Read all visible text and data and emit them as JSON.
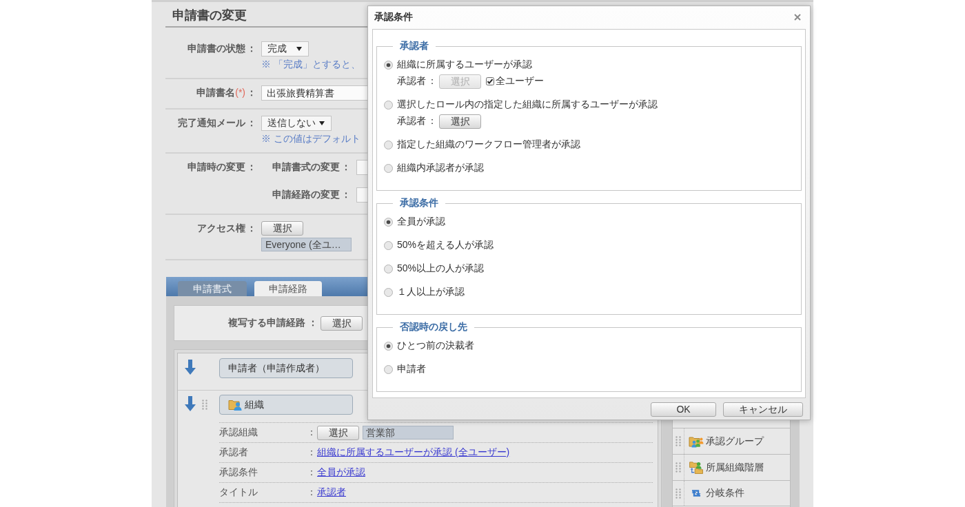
{
  "page": {
    "title": "申請書の変更"
  },
  "form": {
    "rows": [
      {
        "kind": "select",
        "label": "申請書の状態",
        "colon": "：",
        "value": "完成",
        "note": "※ 「完成」とすると、"
      },
      {
        "kind": "text",
        "label": "申請書名",
        "required_mark": "(*)",
        "colon": "：",
        "value": "出張旅費精算書"
      },
      {
        "kind": "select",
        "label": "完了通知メール",
        "colon": "：",
        "value": "送信しない",
        "note": "※ この値はデフォルト"
      },
      {
        "kind": "group",
        "label": "申請時の変更",
        "colon": "：",
        "fields": [
          {
            "label": "申請書式の変更",
            "colon": "："
          },
          {
            "label": "申請経路の変更",
            "colon": "："
          }
        ]
      },
      {
        "kind": "access",
        "label": "アクセス権",
        "colon": "：",
        "button": "選択",
        "value": "Everyone (全ユ…"
      }
    ]
  },
  "tabs": [
    {
      "label": "申請書式",
      "selected": false
    },
    {
      "label": "申請経路",
      "selected": true
    }
  ],
  "route": {
    "copy": {
      "label": "複写する申請経路",
      "colon": "：",
      "button": "選択"
    },
    "steps": [
      {
        "kind": "applicant",
        "name": "申請者（申請作成者）",
        "draggable": false
      },
      {
        "kind": "organization",
        "name": "組織",
        "draggable": true,
        "details": [
          {
            "kind": "picker",
            "label": "承認組織",
            "colon": "：",
            "button": "選択",
            "value": "営業部"
          },
          {
            "kind": "link",
            "label": "承認者",
            "colon": "：",
            "value": "組織に所属するユーザーが承認 (全ユーザー)"
          },
          {
            "kind": "link",
            "label": "承認条件",
            "colon": "：",
            "value": "全員が承認"
          },
          {
            "kind": "link",
            "label": "タイトル",
            "colon": "：",
            "value": "承認者"
          }
        ]
      }
    ]
  },
  "palette": {
    "items": [
      {
        "kind": "approval_group",
        "label": "承認グループ"
      },
      {
        "kind": "org_hierarchy",
        "label": "所属組織階層"
      },
      {
        "kind": "branch",
        "label": "分岐条件"
      }
    ]
  },
  "dialog": {
    "title": "承認条件",
    "sections": [
      {
        "legend": "承認者",
        "options": [
          {
            "label": "組織に所属するユーザーが承認",
            "selected": true,
            "approver": {
              "label": "承認者",
              "colon": "：",
              "button": {
                "label": "選択",
                "disabled": true
              },
              "checkbox": {
                "label": "全ユーザー",
                "checked": true
              }
            }
          },
          {
            "label": "選択したロール内の指定した組織に所属するユーザーが承認",
            "selected": false,
            "approver": {
              "label": "承認者",
              "colon": "：",
              "button": {
                "label": "選択",
                "disabled": false
              }
            }
          },
          {
            "label": "指定した組織のワークフロー管理者が承認",
            "selected": false
          },
          {
            "label": "組織内承認者が承認",
            "selected": false
          }
        ]
      },
      {
        "legend": "承認条件",
        "options": [
          {
            "label": "全員が承認",
            "selected": true
          },
          {
            "label": "50%を超える人が承認",
            "selected": false
          },
          {
            "label": "50%以上の人が承認",
            "selected": false
          },
          {
            "label": "１人以上が承認",
            "selected": false
          }
        ]
      },
      {
        "legend": "否認時の戻し先",
        "options": [
          {
            "label": "ひとつ前の決裁者",
            "selected": true
          },
          {
            "label": "申請者",
            "selected": false
          }
        ]
      }
    ],
    "buttons": [
      {
        "label": "OK"
      },
      {
        "label": "キャンセル"
      }
    ]
  }
}
